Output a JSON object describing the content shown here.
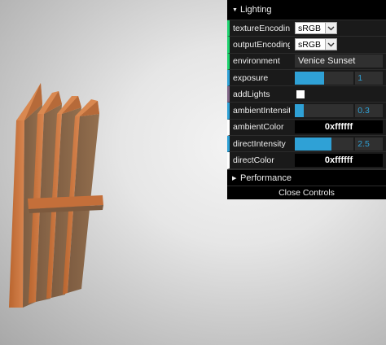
{
  "scene": {
    "model": "wooden-fence-panel",
    "colors": {
      "wood_edge": "#c9733f",
      "wood_face": "#8a6648",
      "background": "#e6e6e6"
    }
  },
  "gui": {
    "folder_lighting": "Lighting",
    "rows": {
      "textureEncoding": {
        "label": "textureEncoding",
        "value": "sRGB"
      },
      "outputEncoding": {
        "label": "outputEncoding",
        "value": "sRGB"
      },
      "environment": {
        "label": "environment",
        "value": "Venice Sunset"
      },
      "exposure": {
        "label": "exposure",
        "value": "1",
        "fraction": 0.5
      },
      "addLights": {
        "label": "addLights",
        "checked": false
      },
      "ambientIntensity": {
        "label": "ambientIntensity",
        "value": "0.3",
        "fraction": 0.15
      },
      "ambientColor": {
        "label": "ambientColor",
        "value": "0xffffff"
      },
      "directIntensity": {
        "label": "directIntensity",
        "value": "2.5",
        "fraction": 0.625
      },
      "directColor": {
        "label": "directColor",
        "value": "0xffffff"
      }
    },
    "folder_performance": "Performance",
    "close_label": "Close Controls",
    "accent_colors": {
      "string": "#1ed36f",
      "number": "#2fa1d6",
      "boolean": "#806787",
      "color": "#ffffff"
    }
  }
}
